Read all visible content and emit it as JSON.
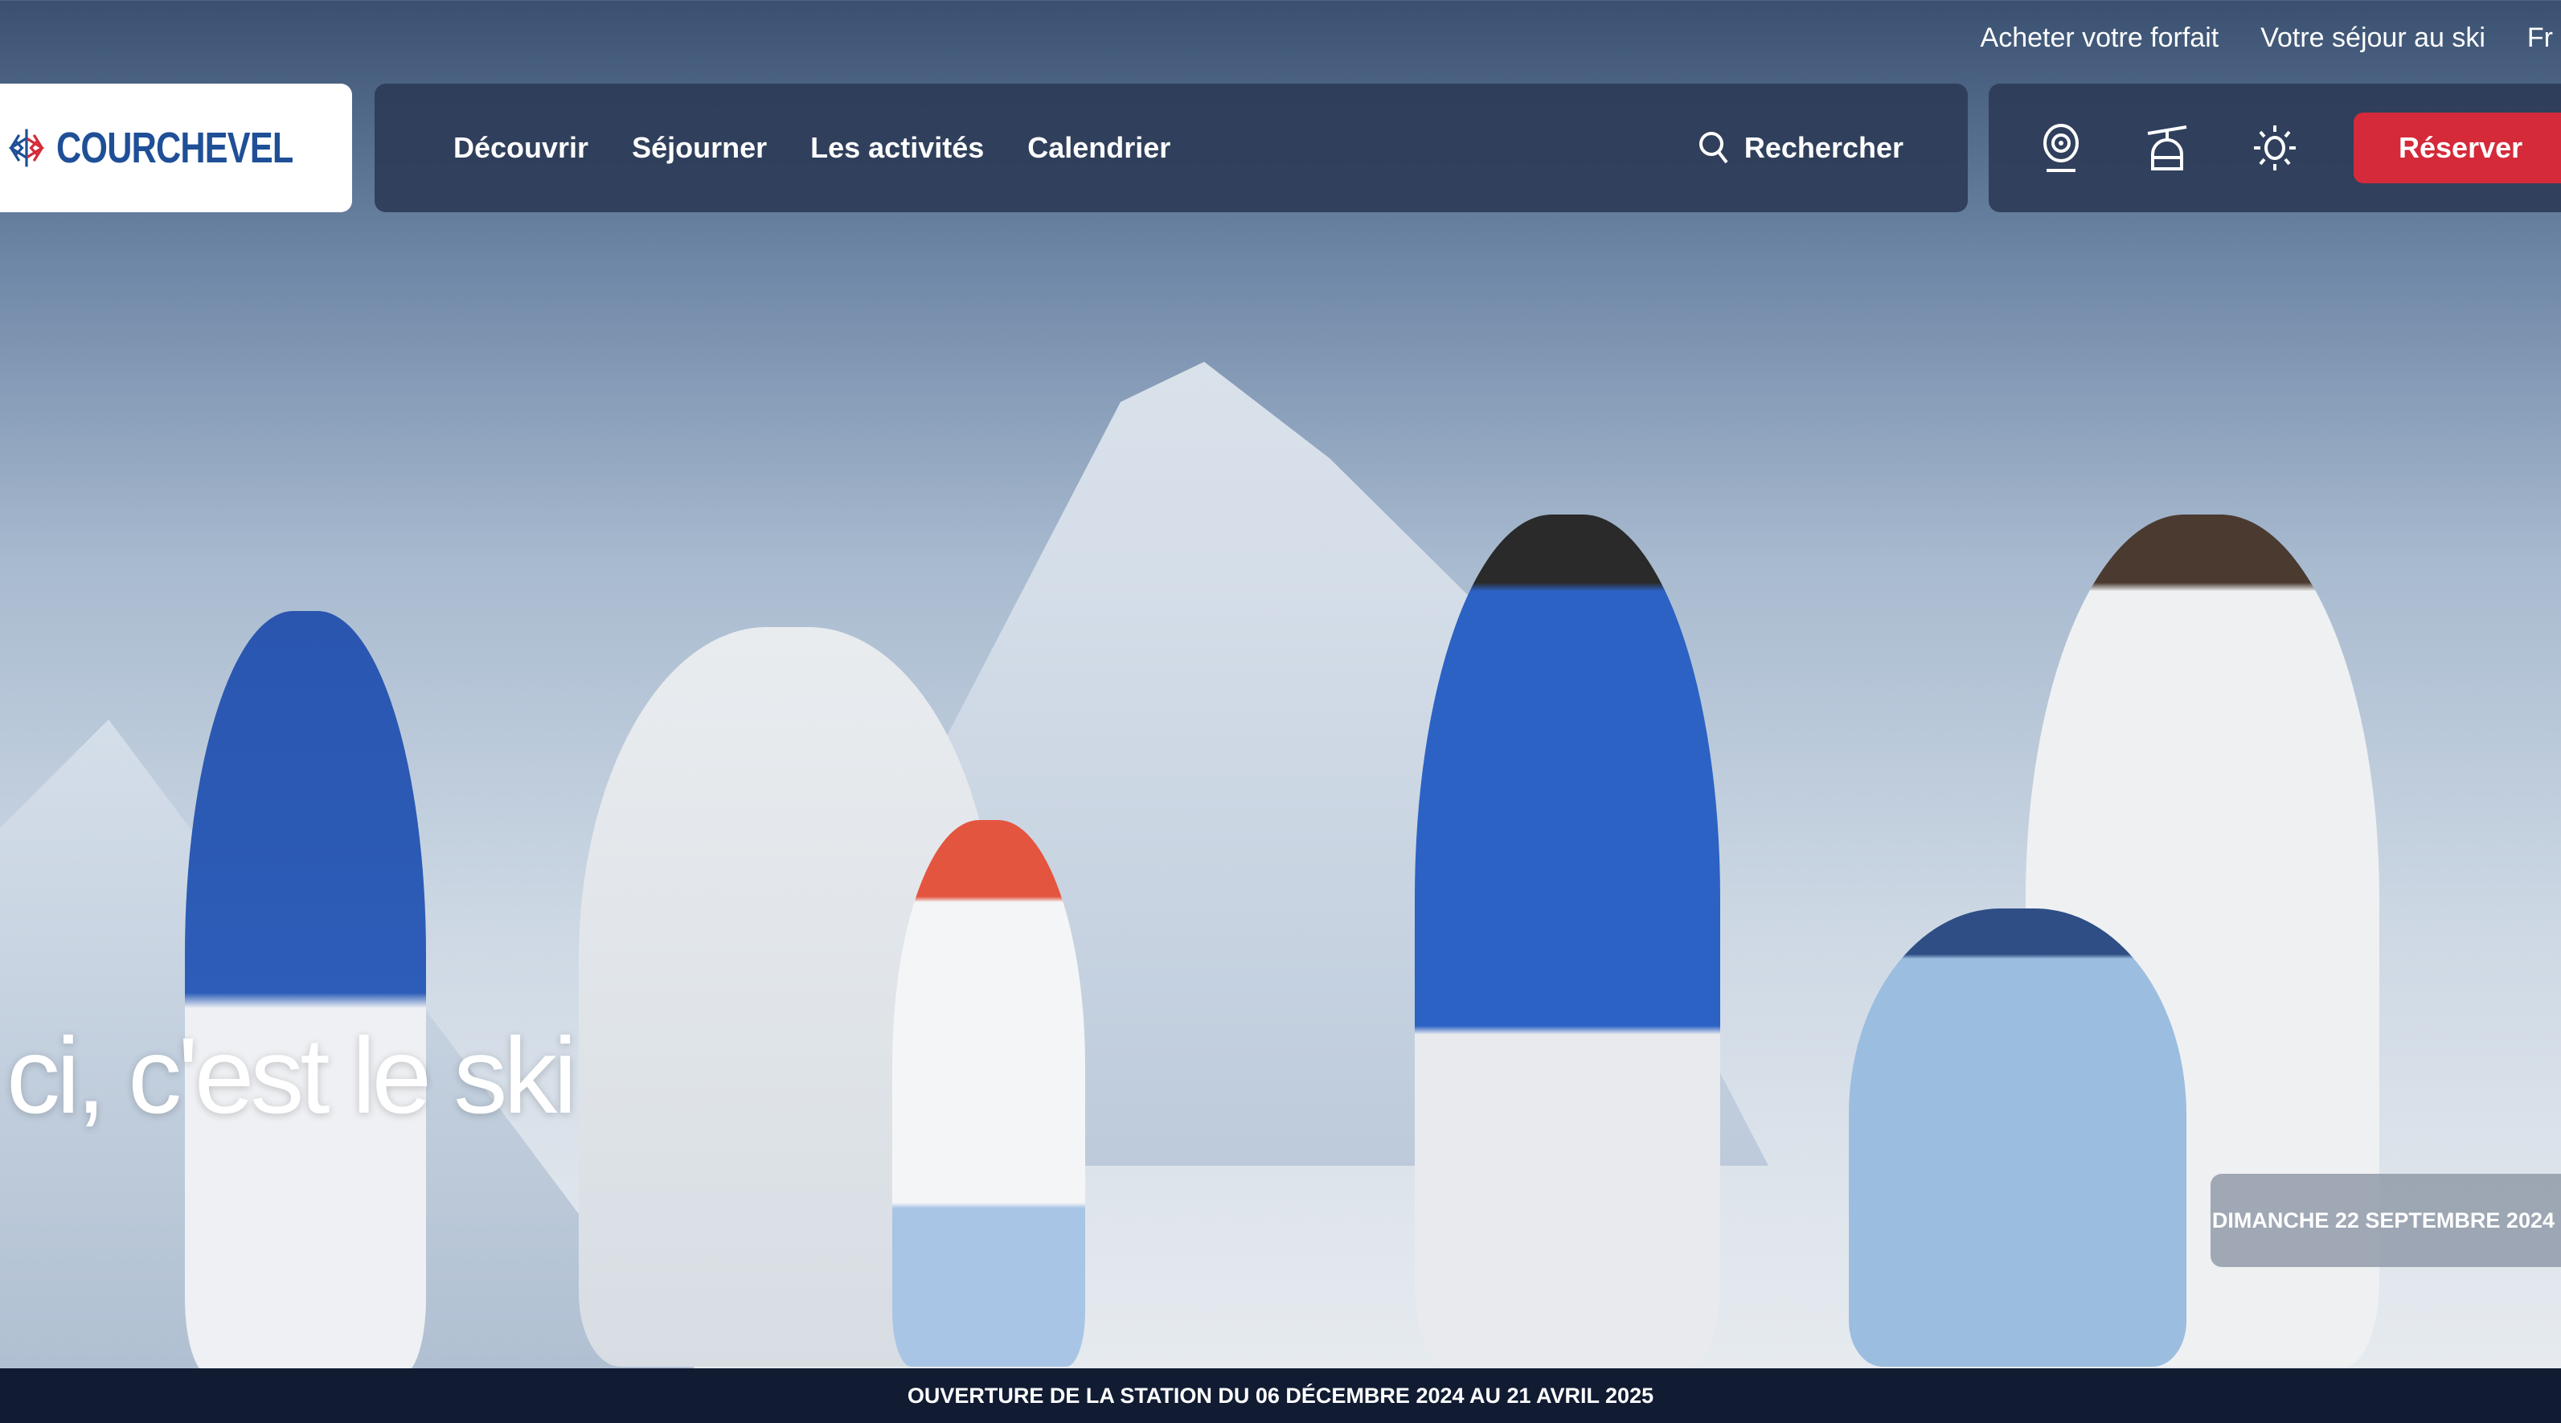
{
  "top_links": [
    "Acheter votre forfait",
    "Votre séjour au ski",
    "Fr"
  ],
  "logo": {
    "text": "COURCHEVEL"
  },
  "nav": {
    "items": [
      "Découvrir",
      "Séjourner",
      "Les activités",
      "Calendrier"
    ],
    "search_label": "Rechercher"
  },
  "tools": {
    "icons": [
      "webcam-icon",
      "cable-car-icon",
      "weather-sun-icon"
    ],
    "reserve_label": "Réserver"
  },
  "hero": {
    "headline": "ci, c'est le ski",
    "date_badge": "DIMANCHE 22 SEPTEMBRE 2024"
  },
  "banner": {
    "text": "OUVERTURE DE LA STATION DU 06 DÉCEMBRE 2024 AU 21 AVRIL 2025"
  },
  "colors": {
    "brand_blue": "#1f4f97",
    "brand_red": "#d42a3a",
    "nav_bg": "#2d3c58",
    "banner_bg": "#111c33"
  }
}
